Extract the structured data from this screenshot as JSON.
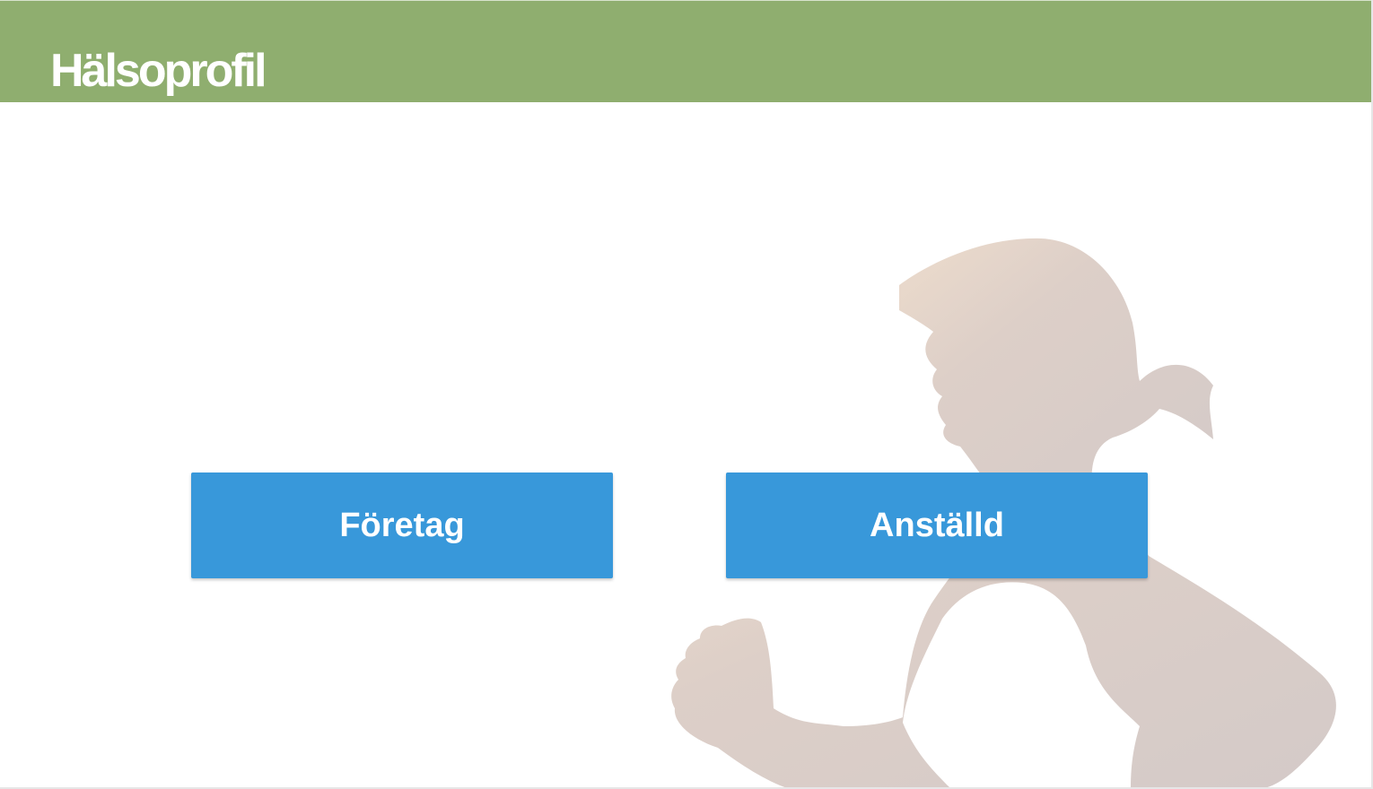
{
  "header": {
    "title": "Hälsoprofil",
    "background_color": "#8fae6f"
  },
  "background_image": {
    "icon": "runner-silhouette-image"
  },
  "choices": {
    "company_label": "Företag",
    "employee_label": "Anställd",
    "button_color": "#3898da"
  }
}
